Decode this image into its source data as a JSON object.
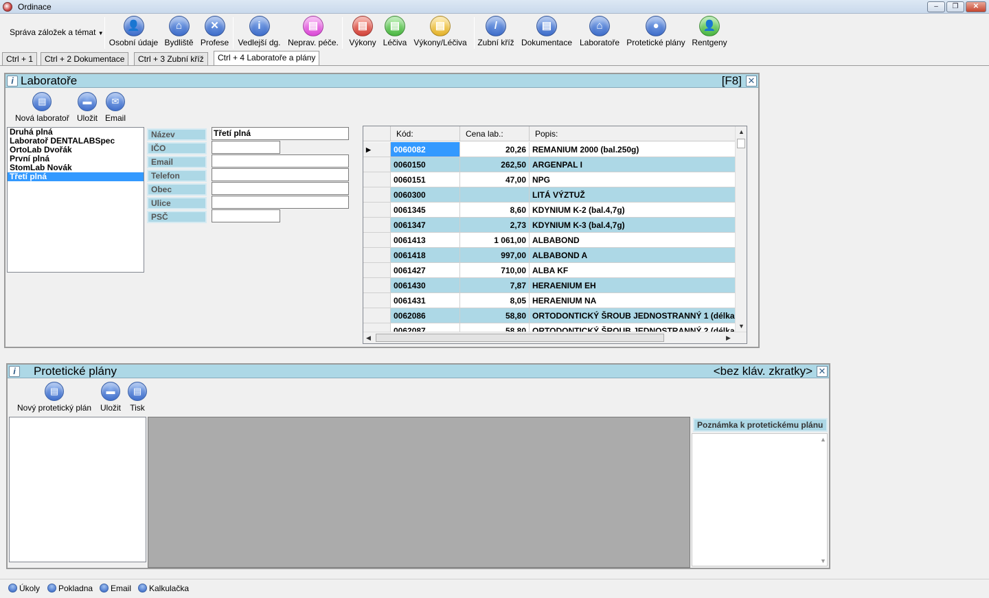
{
  "window": {
    "title": "Ordinace",
    "minimize": "‒",
    "maximize": "❐",
    "close": "✕"
  },
  "toolbar": {
    "topic_menu": "Správa záložek a témat",
    "buttons": [
      {
        "label": "Osobní údaje",
        "icon": "person-icon",
        "glyph": "👤",
        "color": "blue"
      },
      {
        "label": "Bydliště",
        "icon": "home-icon",
        "glyph": "⌂",
        "color": "blue"
      },
      {
        "label": "Profese",
        "icon": "tools-icon",
        "glyph": "✕",
        "color": "blue"
      },
      {
        "label": "Vedlejší dg.",
        "icon": "info-icon",
        "glyph": "i",
        "color": "blue"
      },
      {
        "label": "Neprav. péče.",
        "icon": "documents-icon",
        "glyph": "▤",
        "color": "pink"
      },
      {
        "label": "Výkony",
        "icon": "procedures-icon",
        "glyph": "▤",
        "color": "red"
      },
      {
        "label": "Léčiva",
        "icon": "medicine-icon",
        "glyph": "▤",
        "color": "green"
      },
      {
        "label": "Výkony/Léčiva",
        "icon": "procedures-medicine-icon",
        "glyph": "▤",
        "color": "yellow"
      },
      {
        "label": "Zubní kříž",
        "icon": "dental-cross-icon",
        "glyph": "/",
        "color": "blue"
      },
      {
        "label": "Dokumentace",
        "icon": "documentation-icon",
        "glyph": "▤",
        "color": "blue"
      },
      {
        "label": "Laboratoře",
        "icon": "laboratory-icon",
        "glyph": "⌂",
        "color": "blue"
      },
      {
        "label": "Protetické plány",
        "icon": "chat-icon",
        "glyph": "●",
        "color": "blue"
      },
      {
        "label": "Rentgeny",
        "icon": "xray-icon",
        "glyph": "👤",
        "color": "green"
      }
    ]
  },
  "tabs": [
    "Ctrl + 1",
    "Ctrl + 2 Dokumentace",
    "Ctrl + 3 Zubní kříž",
    "Ctrl + 4 Laboratoře a plány"
  ],
  "labs_panel": {
    "title": "Laboratoře",
    "shortcut": "[F8]",
    "buttons": [
      {
        "label": "Nová laboratoř",
        "glyph": "▤"
      },
      {
        "label": "Uložit",
        "glyph": "▬"
      },
      {
        "label": "Email",
        "glyph": "✉"
      }
    ],
    "list": [
      "Druhá plná",
      "Laboratoř DENTALABSpec",
      "OrtoLab Dvořák",
      "První plná",
      "StomLab Novák",
      "Třetí plná"
    ],
    "selected_index": 5,
    "fields": [
      {
        "label": "Název",
        "value": "Třetí plná"
      },
      {
        "label": "IČO",
        "value": ""
      },
      {
        "label": "Email",
        "value": ""
      },
      {
        "label": "Telefon",
        "value": ""
      },
      {
        "label": "Obec",
        "value": ""
      },
      {
        "label": "Ulice",
        "value": ""
      },
      {
        "label": "PSČ",
        "value": ""
      }
    ],
    "grid": {
      "columns": [
        "Kód:",
        "Cena lab.:",
        "Popis:"
      ],
      "rows": [
        [
          "0060082",
          "20,26",
          "REMANIUM 2000 (bal.250g)"
        ],
        [
          "0060150",
          "262,50",
          "ARGENPAL I"
        ],
        [
          "0060151",
          "47,00",
          "NPG"
        ],
        [
          "0060300",
          "",
          "LITÁ VÝZTUŽ"
        ],
        [
          "0061345",
          "8,60",
          "KDYNIUM K-2 (bal.4,7g)"
        ],
        [
          "0061347",
          "2,73",
          "KDYNIUM K-3 (bal.4,7g)"
        ],
        [
          "0061413",
          "1 061,00",
          "ALBABOND"
        ],
        [
          "0061418",
          "997,00",
          "ALBABOND A"
        ],
        [
          "0061427",
          "710,00",
          "ALBA KF"
        ],
        [
          "0061430",
          "7,87",
          "HERAENIUM EH"
        ],
        [
          "0061431",
          "8,05",
          "HERAENIUM NA"
        ],
        [
          "0062086",
          "58,80",
          "ORTODONTICKÝ ŠROUB JEDNOSTRANNÝ 1 (délka"
        ],
        [
          "0062087",
          "58,80",
          "ORTODONTICKÝ ŠROUB JEDNOSTRANNÝ 2 (délka"
        ]
      ],
      "current_row_marker": "▶",
      "row_colors": [
        "#ffffff",
        "#add8e6"
      ]
    }
  },
  "plans_panel": {
    "title": "Protetické plány",
    "shortcut": "<bez kláv. zkratky>",
    "buttons": [
      {
        "label": "Nový protetický plán",
        "glyph": "▤"
      },
      {
        "label": "Uložit",
        "glyph": "▬"
      },
      {
        "label": "Tisk",
        "glyph": "▤"
      }
    ],
    "note_header": "Poznámka k protetickému plánu"
  },
  "statusbar": [
    "Úkoly",
    "Pokladna",
    "Email",
    "Kalkulačka"
  ]
}
